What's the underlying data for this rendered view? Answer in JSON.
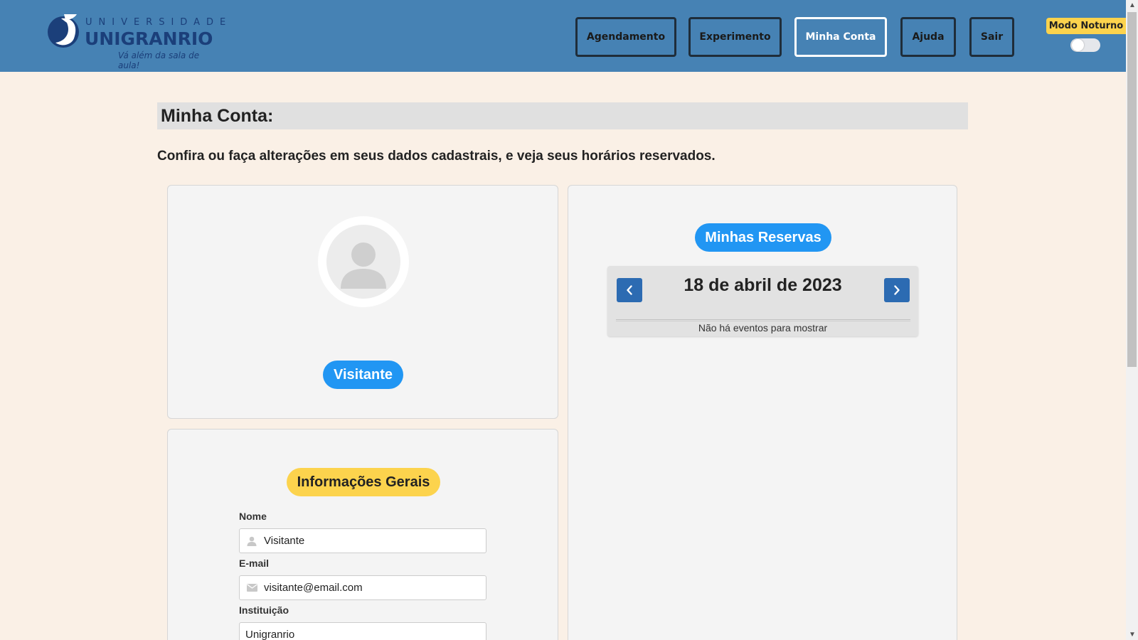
{
  "header": {
    "logo": {
      "line1": "UNIVERSIDADE",
      "line2": "UNIGRANRIO",
      "tagline": "Vá além da sala de aula!"
    },
    "nav": [
      {
        "label": "Agendamento",
        "active": false
      },
      {
        "label": "Experimento",
        "active": false
      },
      {
        "label": "Minha Conta",
        "active": true
      },
      {
        "label": "Ajuda",
        "active": false
      },
      {
        "label": "Sair",
        "active": false
      }
    ],
    "night_mode": {
      "label": "Modo Noturno",
      "enabled": false
    }
  },
  "main": {
    "title": "Minha Conta:",
    "subtitle": "Confira ou faça alterações em seus dados cadastrais, e veja seus horários reservados.",
    "profile": {
      "avatar_icon": "user-icon",
      "name_badge": "Visitante"
    },
    "info": {
      "heading": "Informações Gerais",
      "fields": {
        "nome": {
          "label": "Nome",
          "value": "Visitante",
          "icon": "user-icon"
        },
        "email": {
          "label": "E-mail",
          "value": "visitante@email.com",
          "icon": "envelope-icon"
        },
        "instituicao": {
          "label": "Instituição",
          "value": "Unigranrio"
        }
      }
    },
    "reservas": {
      "heading": "Minhas Reservas",
      "date": "18 de abril de 2023",
      "empty_message": "Não há eventos para mostrar",
      "prev_icon": "chevron-left-icon",
      "next_icon": "chevron-right-icon"
    }
  },
  "colors": {
    "header_bg": "#4682b4",
    "page_bg": "#faf0e6",
    "accent_blue": "#2196f3",
    "accent_yellow": "#fcd34d",
    "nav_button_blue": "#2c6bb2"
  }
}
